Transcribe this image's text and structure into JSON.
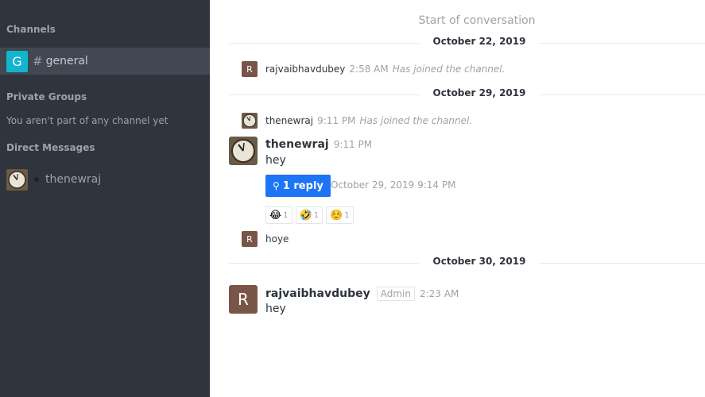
{
  "sidebar": {
    "channels_title": "Channels",
    "channels": [
      {
        "avatar_letter": "G",
        "label": "general",
        "prefix": "#"
      }
    ],
    "private_groups_title": "Private Groups",
    "private_groups_empty": "You aren't part of any channel yet",
    "direct_messages_title": "Direct Messages",
    "direct_messages": [
      {
        "label": "thenewraj"
      }
    ]
  },
  "conversation": {
    "start_label": "Start of conversation",
    "dates": [
      "October 22, 2019",
      "October 29, 2019",
      "October 30, 2019"
    ],
    "system_messages": [
      {
        "avatar_letter": "R",
        "user": "rajvaibhavdubey",
        "time": "2:58 AM",
        "text": "Has joined the channel."
      },
      {
        "user": "thenewraj",
        "time": "9:11 PM",
        "text": "Has joined the channel."
      }
    ],
    "messages": [
      {
        "user": "thenewraj",
        "time": "9:11 PM",
        "body": "hey"
      },
      {
        "avatar_letter": "R",
        "body": "hoye"
      },
      {
        "avatar_letter": "R",
        "user": "rajvaibhavdubey",
        "badge": "Admin",
        "time": "2:23 AM",
        "body": "hey"
      }
    ],
    "thread": {
      "reply_label": "1 reply",
      "time": "October 29, 2019 9:14 PM"
    },
    "reactions": [
      {
        "emoji": "😂",
        "count": "1"
      },
      {
        "emoji": "🤣",
        "count": "1"
      },
      {
        "emoji": "☺️",
        "count": "1"
      }
    ]
  }
}
